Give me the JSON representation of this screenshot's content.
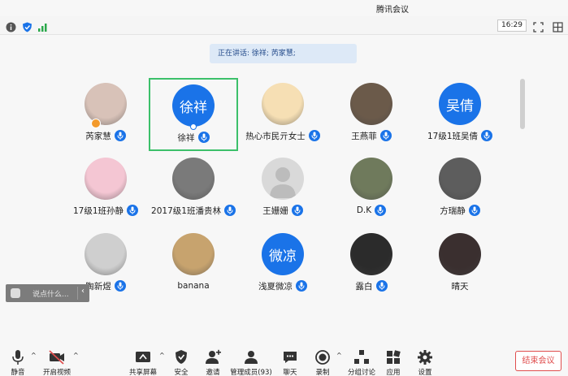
{
  "window": {
    "title": "腾讯会议"
  },
  "status": {
    "time": "16:29"
  },
  "banner": {
    "speaking_text": "正在讲话: 徐祥; 芮家慧;"
  },
  "participants": [
    {
      "name": "芮家慧",
      "avatar": "photo",
      "avatar_text": "",
      "color": "#d8c2b8",
      "mic": "active"
    },
    {
      "name": "徐祥",
      "avatar": "text",
      "avatar_text": "徐祥",
      "color": "#1a73e8",
      "mic": "speaking"
    },
    {
      "name": "热心市民亓女士",
      "avatar": "photo",
      "avatar_text": "",
      "color": "#f6dfb4",
      "mic": "active"
    },
    {
      "name": "王燕菲",
      "avatar": "photo",
      "avatar_text": "",
      "color": "#6b5a4a",
      "mic": "active"
    },
    {
      "name": "17级1班吴倩",
      "avatar": "text",
      "avatar_text": "吴倩",
      "color": "#1a73e8",
      "mic": "active"
    },
    {
      "name": "17级1班孙静",
      "avatar": "photo",
      "avatar_text": "",
      "color": "#f4c6d3",
      "mic": "active"
    },
    {
      "name": "2017级1班潘贵林",
      "avatar": "photo",
      "avatar_text": "",
      "color": "#7a7a7a",
      "mic": "active"
    },
    {
      "name": "王姗姗",
      "avatar": "default",
      "avatar_text": "",
      "color": "#d9d9d9",
      "mic": "active"
    },
    {
      "name": "D.K",
      "avatar": "photo",
      "avatar_text": "",
      "color": "#6f7a5c",
      "mic": "active"
    },
    {
      "name": "方瑞静",
      "avatar": "photo",
      "avatar_text": "",
      "color": "#5d5d5d",
      "mic": "active"
    },
    {
      "name": "陶新煜",
      "avatar": "photo",
      "avatar_text": "",
      "color": "#cfcfcf",
      "mic": "active"
    },
    {
      "name": "banana",
      "avatar": "photo",
      "avatar_text": "",
      "color": "#c7a36e",
      "mic": "none"
    },
    {
      "name": "浅夏微凉",
      "avatar": "text",
      "avatar_text": "微凉",
      "color": "#1a73e8",
      "mic": "active"
    },
    {
      "name": "露白",
      "avatar": "photo",
      "avatar_text": "",
      "color": "#2b2b2b",
      "mic": "active"
    },
    {
      "name": "晴天",
      "avatar": "photo",
      "avatar_text": "",
      "color": "#3a2f2f",
      "mic": "none"
    }
  ],
  "chat": {
    "placeholder": "说点什么..."
  },
  "toolbar": {
    "mute": "静音",
    "video": "开启视频",
    "share": "共享屏幕",
    "security": "安全",
    "invite": "邀请",
    "members": "管理成员(93)",
    "chat": "聊天",
    "record": "录制",
    "breakout": "分组讨论",
    "apps": "应用",
    "settings": "设置",
    "end": "结束会议"
  }
}
